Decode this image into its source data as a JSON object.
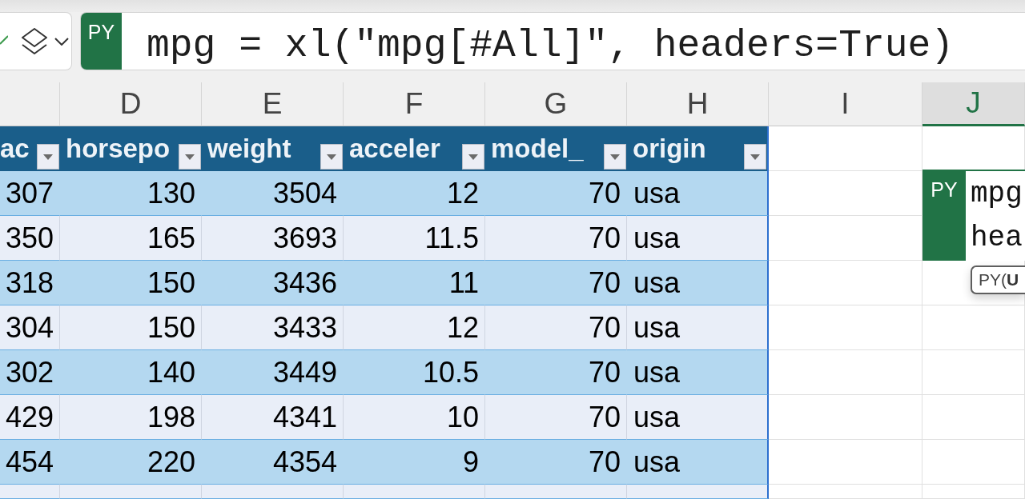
{
  "formula_bar": {
    "badge": "PY",
    "formula": "mpg = xl(\"mpg[#All]\", headers=True)"
  },
  "column_headers": [
    {
      "label": "D",
      "selected": false
    },
    {
      "label": "E",
      "selected": false
    },
    {
      "label": "F",
      "selected": false
    },
    {
      "label": "G",
      "selected": false
    },
    {
      "label": "H",
      "selected": false
    },
    {
      "label": "I",
      "selected": false
    },
    {
      "label": "J",
      "selected": true
    }
  ],
  "table": {
    "columns": [
      {
        "header": "ac",
        "kind": "number"
      },
      {
        "header": "horsepo",
        "kind": "number"
      },
      {
        "header": "weight",
        "kind": "number"
      },
      {
        "header": "acceler",
        "kind": "number"
      },
      {
        "header": "model_",
        "kind": "number"
      },
      {
        "header": "origin",
        "kind": "text"
      }
    ],
    "rows": [
      [
        "307",
        "130",
        "3504",
        "12",
        "70",
        "usa"
      ],
      [
        "350",
        "165",
        "3693",
        "11.5",
        "70",
        "usa"
      ],
      [
        "318",
        "150",
        "3436",
        "11",
        "70",
        "usa"
      ],
      [
        "304",
        "150",
        "3433",
        "12",
        "70",
        "usa"
      ],
      [
        "302",
        "140",
        "3449",
        "10.5",
        "70",
        "usa"
      ],
      [
        "429",
        "198",
        "4341",
        "10",
        "70",
        "usa"
      ],
      [
        "454",
        "220",
        "4354",
        "9",
        "70",
        "usa"
      ]
    ]
  },
  "python_cell": {
    "badge": "PY",
    "lines": [
      "mpg",
      "hea"
    ],
    "tooltip": "PY(**U**"
  }
}
